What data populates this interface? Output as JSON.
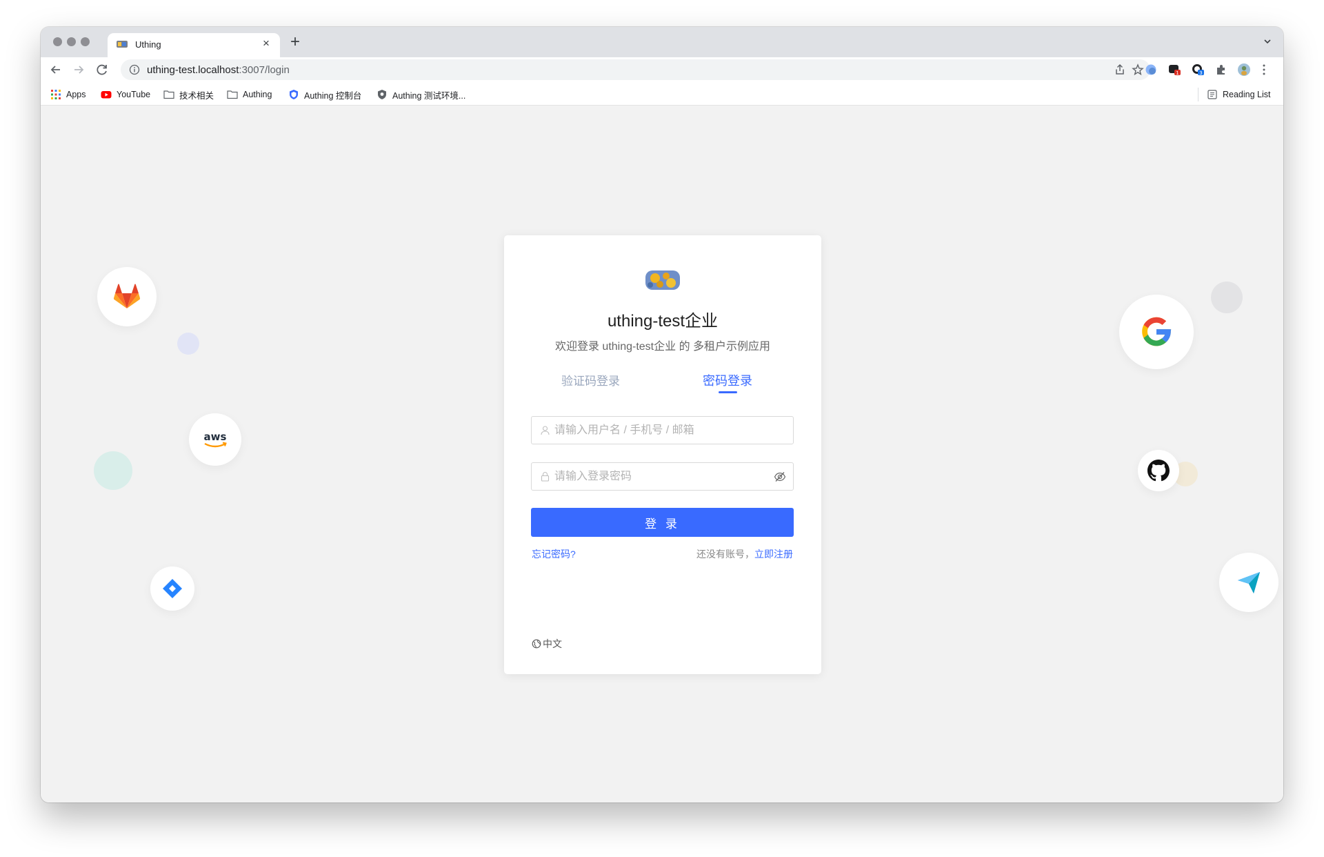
{
  "browser": {
    "tab": {
      "title": "Uthing",
      "close": "×"
    },
    "new_tab": "+",
    "url": {
      "host": "uthing-test.localhost",
      "path": ":3007/login"
    },
    "bookmarks": [
      {
        "label": "Apps"
      },
      {
        "label": "YouTube"
      },
      {
        "label": "技术相关"
      },
      {
        "label": "Authing"
      },
      {
        "label": "Authing 控制台"
      },
      {
        "label": "Authing 测试环境..."
      }
    ],
    "reading_list": "Reading List",
    "extension_badges": {
      "ext_a": "1",
      "ext_b": "3"
    }
  },
  "login": {
    "title": "uthing-test企业",
    "subtitle": "欢迎登录 uthing-test企业 的 多租户示例应用",
    "tabs": {
      "sms": "验证码登录",
      "password": "密码登录",
      "active": "password"
    },
    "username_placeholder": "请输入用户名 / 手机号 / 邮箱",
    "password_placeholder": "请输入登录密码",
    "submit": "登 录",
    "forgot": "忘记密码?",
    "no_account": "还没有账号，",
    "register": "立即注册",
    "language": "中文"
  },
  "background_icons": [
    "gitlab-icon",
    "aws-icon",
    "jira-icon",
    "google-icon",
    "github-icon",
    "feishu-icon"
  ],
  "colors": {
    "accent": "#396aff",
    "page_bg": "#f2f2f2"
  }
}
